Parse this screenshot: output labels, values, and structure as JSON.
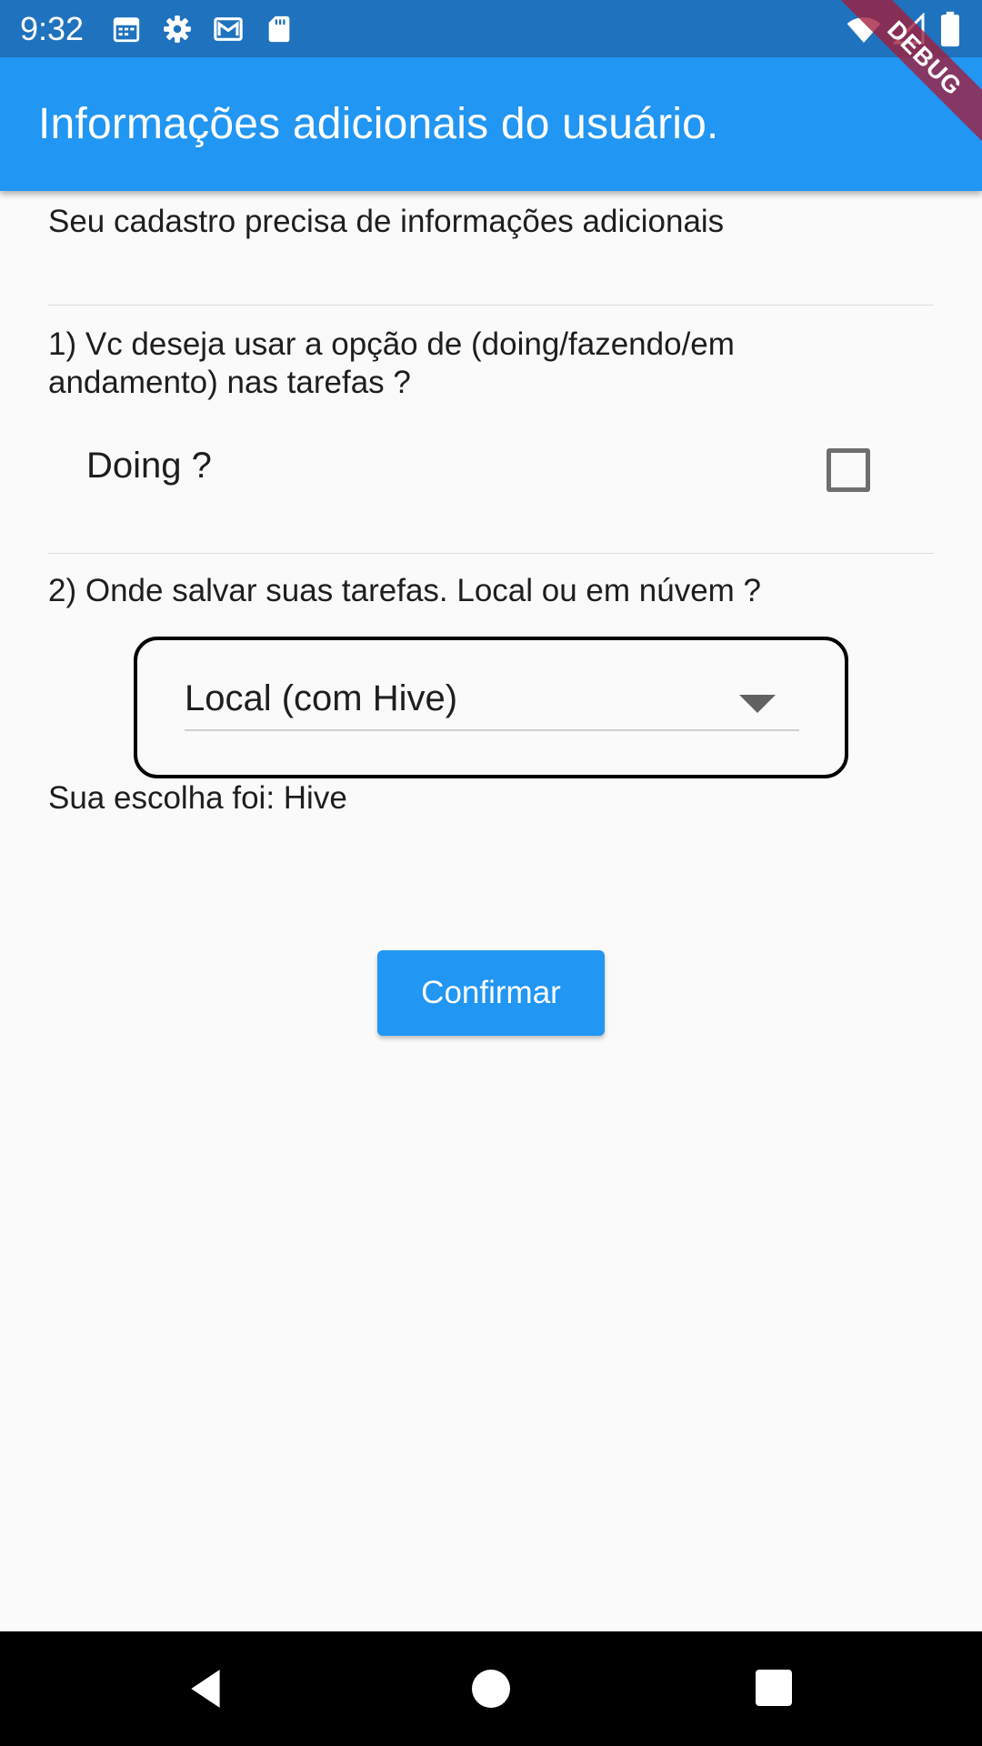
{
  "status_bar": {
    "time": "9:32",
    "left_icons": [
      "calendar-icon",
      "settings-gear-icon",
      "gmail-icon",
      "sd-card-icon"
    ],
    "right_icons": [
      "wifi-icon",
      "signal-icon",
      "battery-icon"
    ]
  },
  "debug_banner": {
    "label": "DEBUG"
  },
  "app_bar": {
    "title": "Informações adicionais do usuário."
  },
  "form": {
    "intro": "Seu cadastro precisa de informações adicionais",
    "question_1": "1) Vc deseja usar a opção de (doing/fazendo/em andamento) nas tarefas ?",
    "doing_label": "Doing ?",
    "doing_checked": false,
    "question_2": "2) Onde salvar suas tarefas. Local ou em núvem ?",
    "storage_selected": "Local (com Hive)",
    "choice_text": "Sua escolha foi: Hive",
    "confirm_label": "Confirmar"
  },
  "nav_bar": {
    "buttons": [
      "back-icon",
      "home-icon",
      "recent-apps-icon"
    ]
  },
  "colors": {
    "status_bar": "#1f72bd",
    "app_bar": "#2196f3",
    "button": "#2196f3",
    "background": "#fafafa",
    "debug_ribbon": "#a31c3a"
  }
}
